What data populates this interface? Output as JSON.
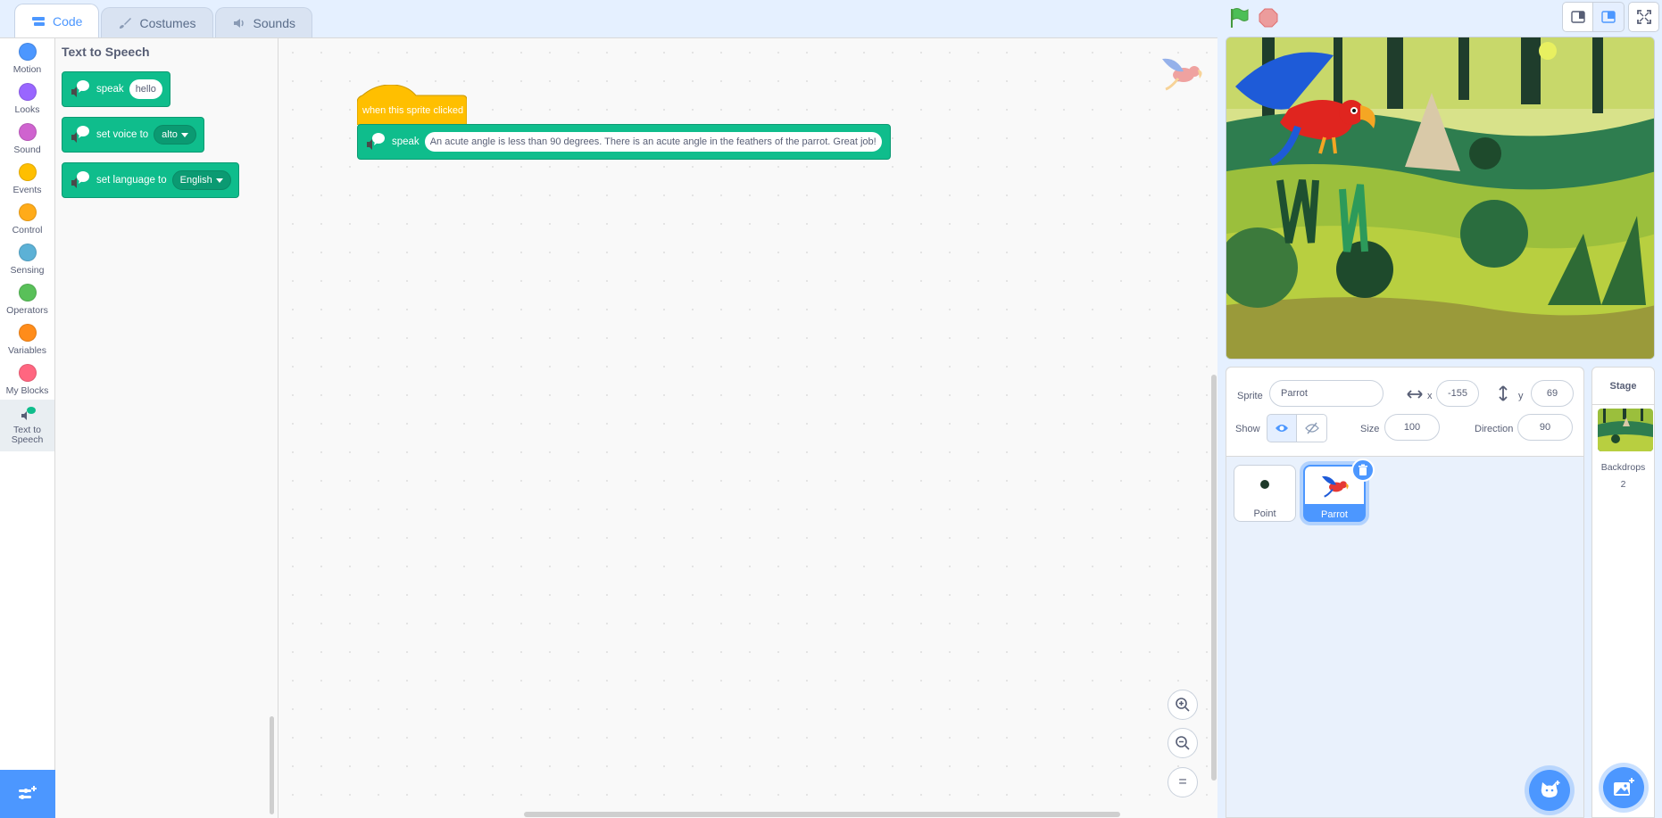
{
  "tabs": [
    {
      "label": "Code",
      "icon": "code-icon",
      "active": true
    },
    {
      "label": "Costumes",
      "icon": "brush-icon",
      "active": false
    },
    {
      "label": "Sounds",
      "icon": "speaker-icon",
      "active": false
    }
  ],
  "categories": [
    {
      "label": "Motion",
      "color": "#4c97ff"
    },
    {
      "label": "Looks",
      "color": "#9966ff"
    },
    {
      "label": "Sound",
      "color": "#cf63cf"
    },
    {
      "label": "Events",
      "color": "#ffbf00"
    },
    {
      "label": "Control",
      "color": "#ffab19"
    },
    {
      "label": "Sensing",
      "color": "#5cb1d6"
    },
    {
      "label": "Operators",
      "color": "#59c059"
    },
    {
      "label": "Variables",
      "color": "#ff8c1a"
    },
    {
      "label": "My Blocks",
      "color": "#ff6680"
    }
  ],
  "selected_category": {
    "line1": "Text to",
    "line2": "Speech"
  },
  "palette": {
    "title": "Text to Speech",
    "speak_label": "speak",
    "speak_value": "hello",
    "set_voice_label": "set voice to",
    "set_voice_value": "alto",
    "set_language_label": "set language to",
    "set_language_value": "English"
  },
  "script": {
    "hat_label": "when this sprite clicked",
    "speak_label": "speak",
    "speak_text": "An acute angle is less than 90 degrees. There is an acute angle in the feathers of the parrot. Great job!"
  },
  "zoom": {
    "in": "+",
    "out": "−",
    "reset": "="
  },
  "sprite_info": {
    "sprite_label": "Sprite",
    "sprite_name": "Parrot",
    "x_label": "x",
    "x_value": "-155",
    "y_label": "y",
    "y_value": "69",
    "show_label": "Show",
    "size_label": "Size",
    "size_value": "100",
    "direction_label": "Direction",
    "direction_value": "90"
  },
  "sprites": [
    {
      "name": "Point",
      "selected": false
    },
    {
      "name": "Parrot",
      "selected": true
    }
  ],
  "stage_pane": {
    "title": "Stage",
    "backdrops_label": "Backdrops",
    "backdrops_count": "2"
  },
  "colors": {
    "accent": "#4c97ff",
    "tts_block": "#0fbd8c",
    "events_block": "#ffbf00"
  }
}
